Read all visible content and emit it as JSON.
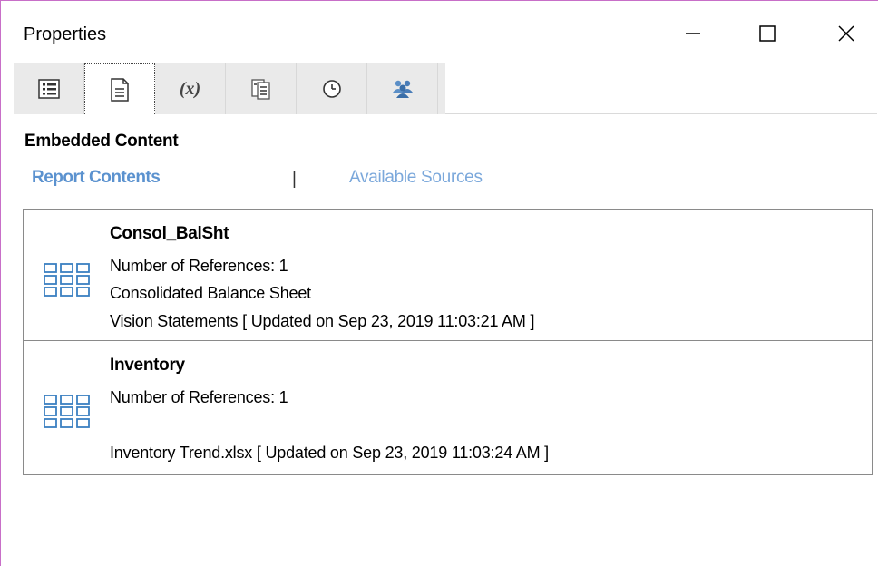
{
  "window": {
    "title": "Properties",
    "controls": [
      "minimize-icon",
      "maximize-icon",
      "close-icon"
    ]
  },
  "toolbar": {
    "tabs": [
      {
        "icon": "list-icon",
        "label": ""
      },
      {
        "icon": "document-icon",
        "label": "",
        "selected": true
      },
      {
        "icon": "variable-icon",
        "label": "(x)"
      },
      {
        "icon": "copy-document-icon",
        "label": ""
      },
      {
        "icon": "clock-icon",
        "label": ""
      },
      {
        "icon": "users-icon",
        "label": ""
      }
    ]
  },
  "section": {
    "title": "Embedded Content"
  },
  "subtabs": {
    "active": "Report Contents",
    "separator": "|",
    "inactive": "Available Sources"
  },
  "items": [
    {
      "name": "Consol_BalSht",
      "line1": "Number of References: 1",
      "line2": "Consolidated Balance Sheet",
      "line3": "Vision Statements [ Updated on Sep 23, 2019 11:03:21 AM ]",
      "icon": "grid-icon"
    },
    {
      "name": "Inventory",
      "line1": "Number of References: 1",
      "line2": "",
      "line3": "Inventory Trend.xlsx [ Updated on Sep 23, 2019 11:03:24 AM ]",
      "icon": "grid-icon"
    }
  ],
  "colors": {
    "accent": "#5b92cf",
    "accent_light": "#7ba8db",
    "icon_blue": "#3a7fc1",
    "window_border": "#c86fc8"
  }
}
